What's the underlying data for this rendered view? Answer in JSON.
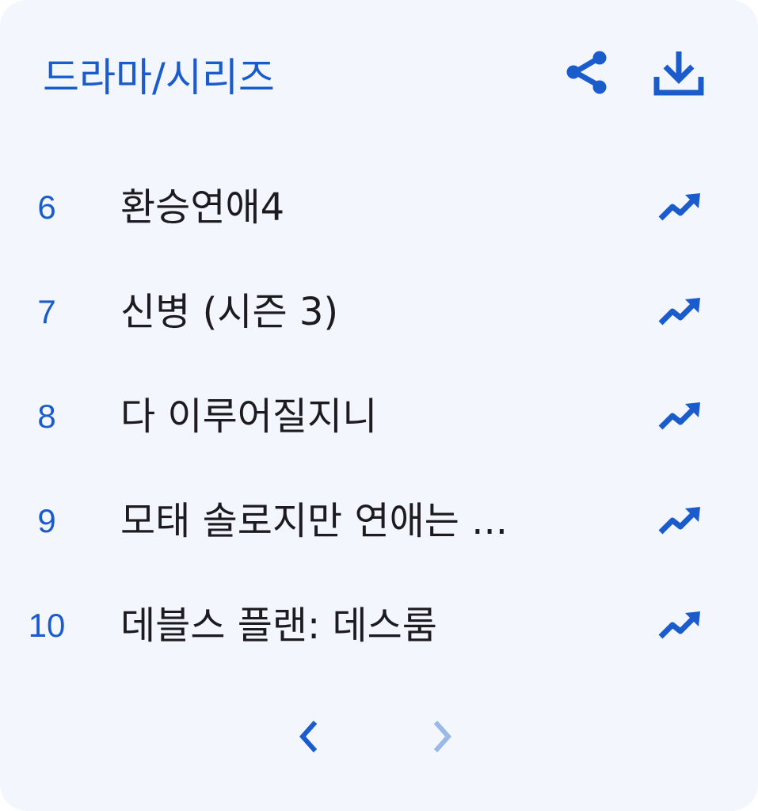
{
  "header": {
    "title": "드라마/시리즈",
    "share_icon": "share-icon",
    "download_icon": "download-icon"
  },
  "colors": {
    "accent": "#1a5ccb",
    "background": "#f3f7fd",
    "text": "#1d1b20",
    "disabled": "#9bb9e6"
  },
  "items": [
    {
      "rank": "6",
      "name": "환승연애4",
      "trend_icon": "trending-up-icon"
    },
    {
      "rank": "7",
      "name": "신병 (시즌 3)",
      "trend_icon": "trending-up-icon"
    },
    {
      "rank": "8",
      "name": "다 이루어질지니",
      "trend_icon": "trending-up-icon"
    },
    {
      "rank": "9",
      "name": "모태 솔로지만 연애는 ...",
      "trend_icon": "trending-up-icon"
    },
    {
      "rank": "10",
      "name": "데블스 플랜: 데스룸",
      "trend_icon": "trending-up-icon"
    }
  ],
  "pagination": {
    "prev_icon": "chevron-left-icon",
    "next_icon": "chevron-right-icon",
    "next_disabled": true
  }
}
